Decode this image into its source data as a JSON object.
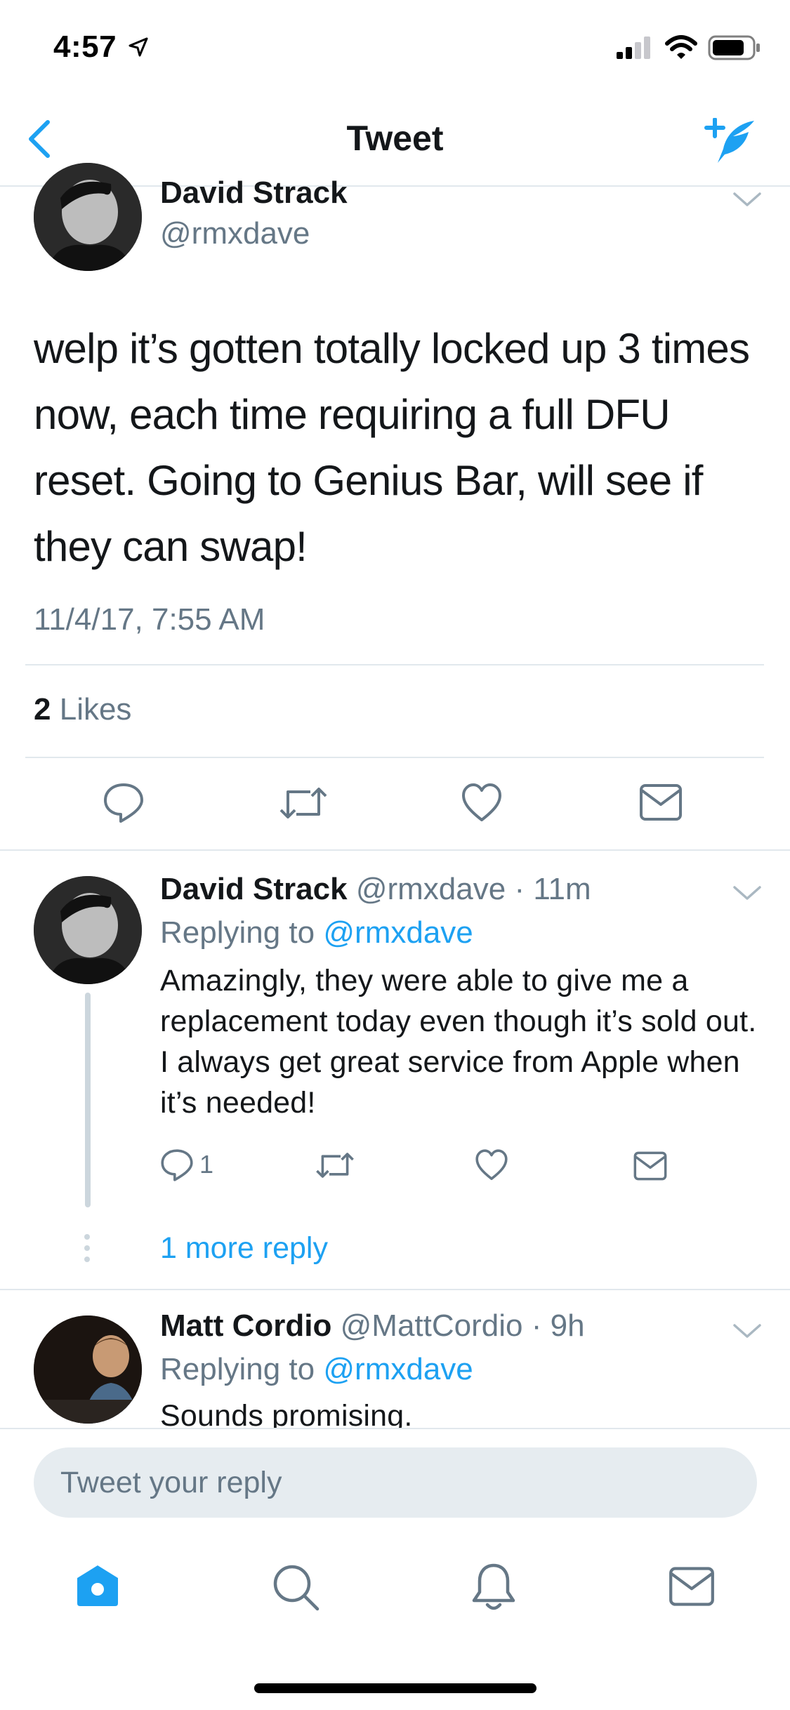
{
  "status_bar": {
    "time": "4:57"
  },
  "nav": {
    "title": "Tweet"
  },
  "tweet": {
    "author_name": "David Strack",
    "author_handle": "@rmxdave",
    "text": "welp it’s gotten totally locked up 3 times now, each time requiring a full DFU reset. Going to Genius Bar, will see if they can swap!",
    "timestamp": "11/4/17, 7:55 AM",
    "likes_count": "2",
    "likes_label": "Likes"
  },
  "replies": [
    {
      "author_name": "David Strack",
      "author_handle": "@rmxdave",
      "time": "· 11m",
      "replying_prefix": "Replying to",
      "replying_handle": "@rmxdave",
      "text": "Amazingly, they were able to give me a replacement today even though it’s sold out. I always get great service from Apple when it’s needed!",
      "reply_count": "1"
    },
    {
      "author_name": "Matt Cordio",
      "author_handle": "@MattCordio",
      "time": "· 9h",
      "replying_prefix": "Replying to",
      "replying_handle": "@rmxdave",
      "text": "Sounds promising."
    }
  ],
  "more_replies_label": "1 more reply",
  "composer": {
    "placeholder": "Tweet your reply"
  },
  "tab_bar": {
    "items": [
      "home-icon",
      "search-icon",
      "notifications-icon",
      "messages-icon"
    ]
  },
  "colors": {
    "accent": "#1da1f2",
    "text": "#14171a",
    "muted": "#657786",
    "divider": "#e1e8ed"
  }
}
